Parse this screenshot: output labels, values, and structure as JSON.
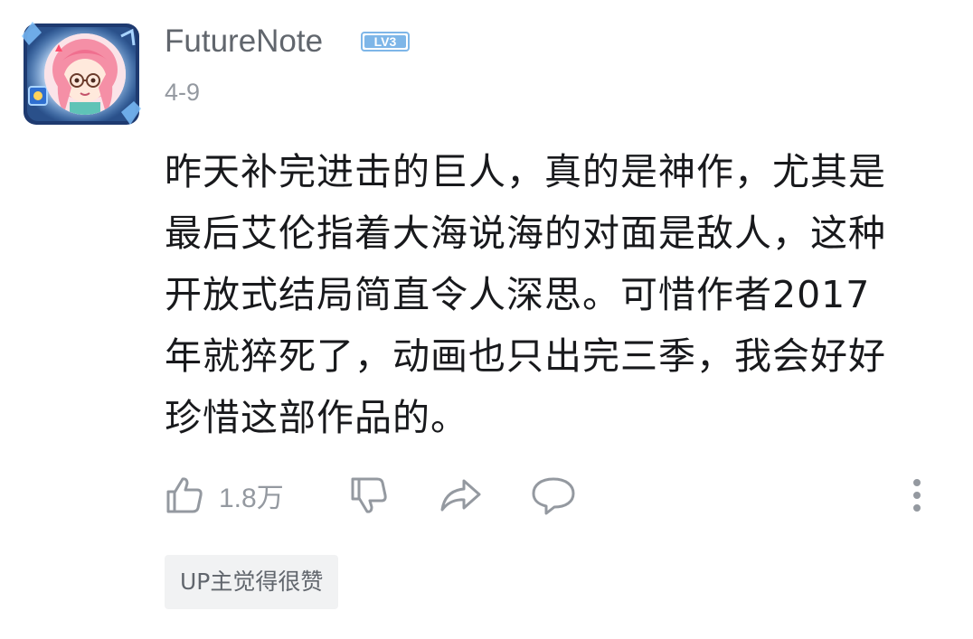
{
  "comment": {
    "author": {
      "name": "FutureNote",
      "level_badge": "LV3"
    },
    "date": "4-9",
    "text_lines": [
      "昨天补完进击的巨人，真的是神作，尤其是",
      "最后艾伦指着大海说海的对面是敌人，这种",
      "开放式结局简直令人深思。可惜作者2017",
      "年就猝死了，动画也只出完三季，我会好好",
      "珍惜这部作品的。"
    ],
    "actions": {
      "like_icon": "thumbs-up-icon",
      "like_count": "1.8万",
      "dislike_icon": "thumbs-down-icon",
      "share_icon": "share-icon",
      "reply_icon": "comment-bubble-icon",
      "more_icon": "more-vertical-icon"
    },
    "up_tag": "UP主觉得很赞"
  },
  "colors": {
    "username": "#61666d",
    "meta_text": "#9499a0",
    "body_text": "#18191c",
    "icon": "#9499a0",
    "badge": "#7eb6e8",
    "tag_bg": "#f1f2f3",
    "avatar_frame": "#5aa8f0"
  }
}
